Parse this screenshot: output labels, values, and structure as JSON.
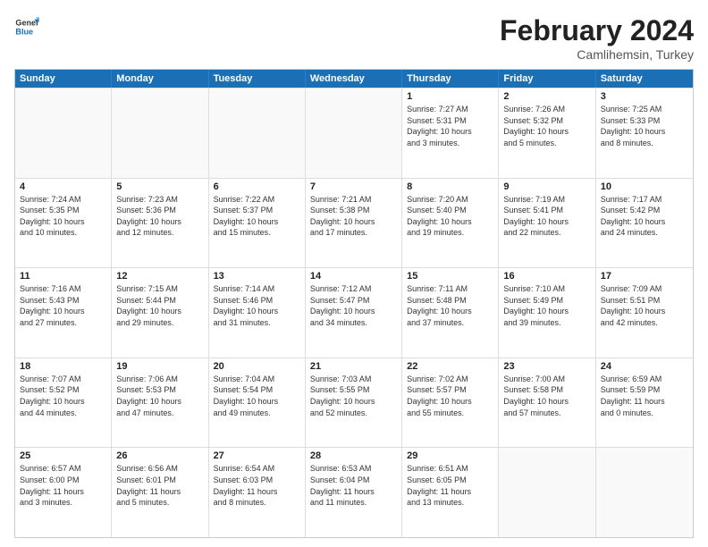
{
  "logo": {
    "line1": "General",
    "line2": "Blue"
  },
  "title": {
    "month_year": "February 2024",
    "location": "Camlihemsin, Turkey"
  },
  "weekdays": [
    "Sunday",
    "Monday",
    "Tuesday",
    "Wednesday",
    "Thursday",
    "Friday",
    "Saturday"
  ],
  "rows": [
    [
      {
        "day": "",
        "lines": []
      },
      {
        "day": "",
        "lines": []
      },
      {
        "day": "",
        "lines": []
      },
      {
        "day": "",
        "lines": []
      },
      {
        "day": "1",
        "lines": [
          "Sunrise: 7:27 AM",
          "Sunset: 5:31 PM",
          "Daylight: 10 hours",
          "and 3 minutes."
        ]
      },
      {
        "day": "2",
        "lines": [
          "Sunrise: 7:26 AM",
          "Sunset: 5:32 PM",
          "Daylight: 10 hours",
          "and 5 minutes."
        ]
      },
      {
        "day": "3",
        "lines": [
          "Sunrise: 7:25 AM",
          "Sunset: 5:33 PM",
          "Daylight: 10 hours",
          "and 8 minutes."
        ]
      }
    ],
    [
      {
        "day": "4",
        "lines": [
          "Sunrise: 7:24 AM",
          "Sunset: 5:35 PM",
          "Daylight: 10 hours",
          "and 10 minutes."
        ]
      },
      {
        "day": "5",
        "lines": [
          "Sunrise: 7:23 AM",
          "Sunset: 5:36 PM",
          "Daylight: 10 hours",
          "and 12 minutes."
        ]
      },
      {
        "day": "6",
        "lines": [
          "Sunrise: 7:22 AM",
          "Sunset: 5:37 PM",
          "Daylight: 10 hours",
          "and 15 minutes."
        ]
      },
      {
        "day": "7",
        "lines": [
          "Sunrise: 7:21 AM",
          "Sunset: 5:38 PM",
          "Daylight: 10 hours",
          "and 17 minutes."
        ]
      },
      {
        "day": "8",
        "lines": [
          "Sunrise: 7:20 AM",
          "Sunset: 5:40 PM",
          "Daylight: 10 hours",
          "and 19 minutes."
        ]
      },
      {
        "day": "9",
        "lines": [
          "Sunrise: 7:19 AM",
          "Sunset: 5:41 PM",
          "Daylight: 10 hours",
          "and 22 minutes."
        ]
      },
      {
        "day": "10",
        "lines": [
          "Sunrise: 7:17 AM",
          "Sunset: 5:42 PM",
          "Daylight: 10 hours",
          "and 24 minutes."
        ]
      }
    ],
    [
      {
        "day": "11",
        "lines": [
          "Sunrise: 7:16 AM",
          "Sunset: 5:43 PM",
          "Daylight: 10 hours",
          "and 27 minutes."
        ]
      },
      {
        "day": "12",
        "lines": [
          "Sunrise: 7:15 AM",
          "Sunset: 5:44 PM",
          "Daylight: 10 hours",
          "and 29 minutes."
        ]
      },
      {
        "day": "13",
        "lines": [
          "Sunrise: 7:14 AM",
          "Sunset: 5:46 PM",
          "Daylight: 10 hours",
          "and 31 minutes."
        ]
      },
      {
        "day": "14",
        "lines": [
          "Sunrise: 7:12 AM",
          "Sunset: 5:47 PM",
          "Daylight: 10 hours",
          "and 34 minutes."
        ]
      },
      {
        "day": "15",
        "lines": [
          "Sunrise: 7:11 AM",
          "Sunset: 5:48 PM",
          "Daylight: 10 hours",
          "and 37 minutes."
        ]
      },
      {
        "day": "16",
        "lines": [
          "Sunrise: 7:10 AM",
          "Sunset: 5:49 PM",
          "Daylight: 10 hours",
          "and 39 minutes."
        ]
      },
      {
        "day": "17",
        "lines": [
          "Sunrise: 7:09 AM",
          "Sunset: 5:51 PM",
          "Daylight: 10 hours",
          "and 42 minutes."
        ]
      }
    ],
    [
      {
        "day": "18",
        "lines": [
          "Sunrise: 7:07 AM",
          "Sunset: 5:52 PM",
          "Daylight: 10 hours",
          "and 44 minutes."
        ]
      },
      {
        "day": "19",
        "lines": [
          "Sunrise: 7:06 AM",
          "Sunset: 5:53 PM",
          "Daylight: 10 hours",
          "and 47 minutes."
        ]
      },
      {
        "day": "20",
        "lines": [
          "Sunrise: 7:04 AM",
          "Sunset: 5:54 PM",
          "Daylight: 10 hours",
          "and 49 minutes."
        ]
      },
      {
        "day": "21",
        "lines": [
          "Sunrise: 7:03 AM",
          "Sunset: 5:55 PM",
          "Daylight: 10 hours",
          "and 52 minutes."
        ]
      },
      {
        "day": "22",
        "lines": [
          "Sunrise: 7:02 AM",
          "Sunset: 5:57 PM",
          "Daylight: 10 hours",
          "and 55 minutes."
        ]
      },
      {
        "day": "23",
        "lines": [
          "Sunrise: 7:00 AM",
          "Sunset: 5:58 PM",
          "Daylight: 10 hours",
          "and 57 minutes."
        ]
      },
      {
        "day": "24",
        "lines": [
          "Sunrise: 6:59 AM",
          "Sunset: 5:59 PM",
          "Daylight: 11 hours",
          "and 0 minutes."
        ]
      }
    ],
    [
      {
        "day": "25",
        "lines": [
          "Sunrise: 6:57 AM",
          "Sunset: 6:00 PM",
          "Daylight: 11 hours",
          "and 3 minutes."
        ]
      },
      {
        "day": "26",
        "lines": [
          "Sunrise: 6:56 AM",
          "Sunset: 6:01 PM",
          "Daylight: 11 hours",
          "and 5 minutes."
        ]
      },
      {
        "day": "27",
        "lines": [
          "Sunrise: 6:54 AM",
          "Sunset: 6:03 PM",
          "Daylight: 11 hours",
          "and 8 minutes."
        ]
      },
      {
        "day": "28",
        "lines": [
          "Sunrise: 6:53 AM",
          "Sunset: 6:04 PM",
          "Daylight: 11 hours",
          "and 11 minutes."
        ]
      },
      {
        "day": "29",
        "lines": [
          "Sunrise: 6:51 AM",
          "Sunset: 6:05 PM",
          "Daylight: 11 hours",
          "and 13 minutes."
        ]
      },
      {
        "day": "",
        "lines": []
      },
      {
        "day": "",
        "lines": []
      }
    ]
  ]
}
